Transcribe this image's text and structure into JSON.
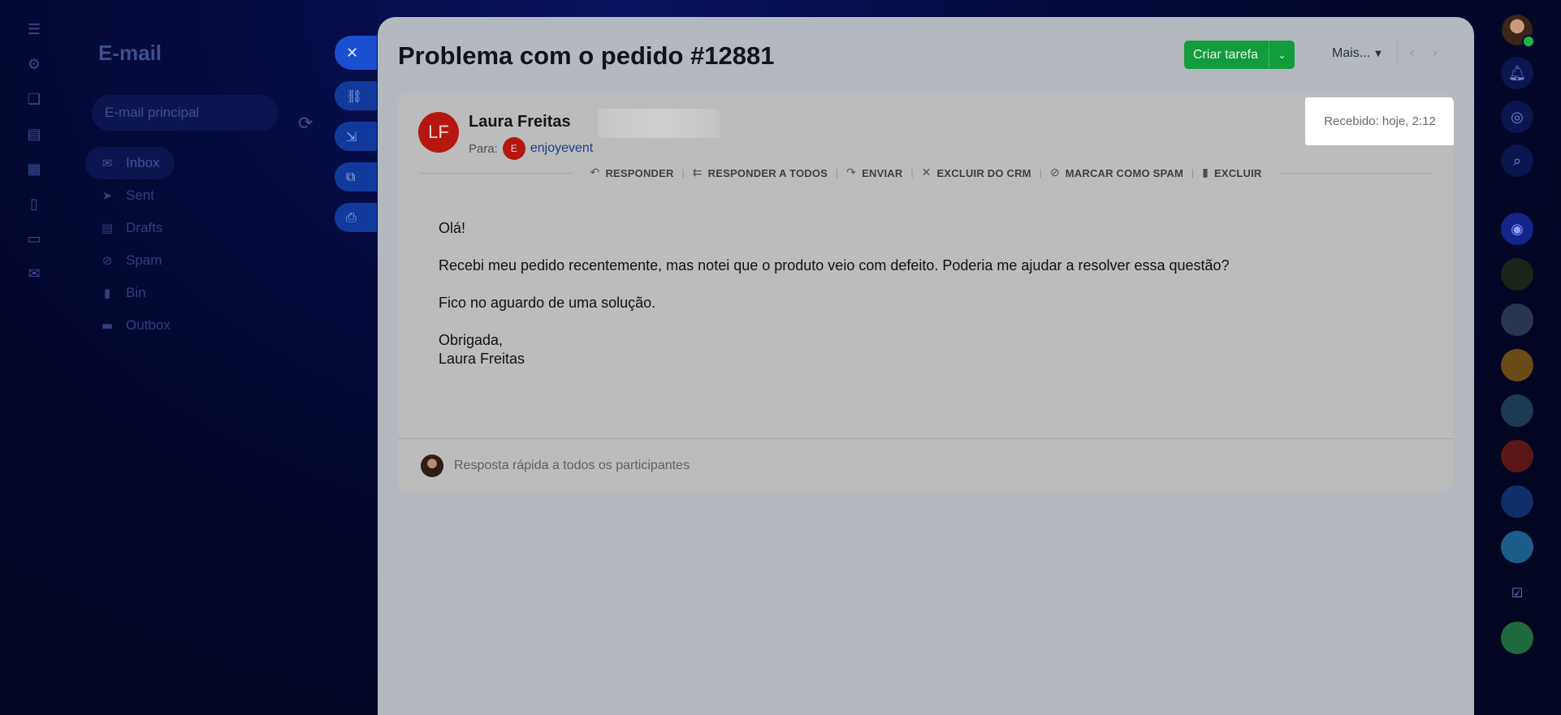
{
  "background": {
    "section_title": "E-mail",
    "mailbox_selector": "E-mail principal",
    "folders": [
      {
        "icon": "envelope-icon",
        "label": "Inbox",
        "active": true
      },
      {
        "icon": "sent-icon",
        "label": "Sent",
        "active": false
      },
      {
        "icon": "draft-icon",
        "label": "Drafts",
        "active": false
      },
      {
        "icon": "spam-icon",
        "label": "Spam",
        "active": false
      },
      {
        "icon": "trash-icon",
        "label": "Bin",
        "active": false
      },
      {
        "icon": "outbox-icon",
        "label": "Outbox",
        "active": false
      }
    ],
    "side_tools": [
      "close-icon",
      "link-icon",
      "download-icon",
      "open-external-icon",
      "print-icon"
    ]
  },
  "header": {
    "subject": "Problema com o pedido #12881",
    "create_task_label": "Criar tarefa",
    "more_label": "Mais..."
  },
  "email": {
    "sender_initials": "LF",
    "sender_name": "Laura Freitas",
    "to_label": "Para:",
    "recipient_initial": "E",
    "recipient_name": "enjoyevent",
    "received": "Recebido: hoje, 2:12",
    "actions": [
      {
        "icon": "reply-icon",
        "label": "RESPONDER"
      },
      {
        "icon": "reply-all-icon",
        "label": "RESPONDER A TODOS"
      },
      {
        "icon": "forward-icon",
        "label": "ENVIAR"
      },
      {
        "icon": "remove-crm-icon",
        "label": "EXCLUIR DO CRM"
      },
      {
        "icon": "block-icon",
        "label": "MARCAR COMO SPAM"
      },
      {
        "icon": "trash-icon",
        "label": "EXCLUIR"
      }
    ],
    "body": {
      "greeting": "Olá!",
      "paragraph1": "Recebi meu pedido recentemente, mas notei que o produto veio com defeito. Poderia me ajudar a resolver essa questão?",
      "paragraph2": "Fico no aguardo de uma solução.",
      "closing": "Obrigada,",
      "signature": "Laura Freitas"
    },
    "quick_reply_placeholder": "Resposta rápida a todos os participantes"
  },
  "colors": {
    "accent_green": "#129c3c",
    "avatar_red": "#b3170f",
    "link_blue": "#1b3f86",
    "highlight": "#ffffff"
  }
}
